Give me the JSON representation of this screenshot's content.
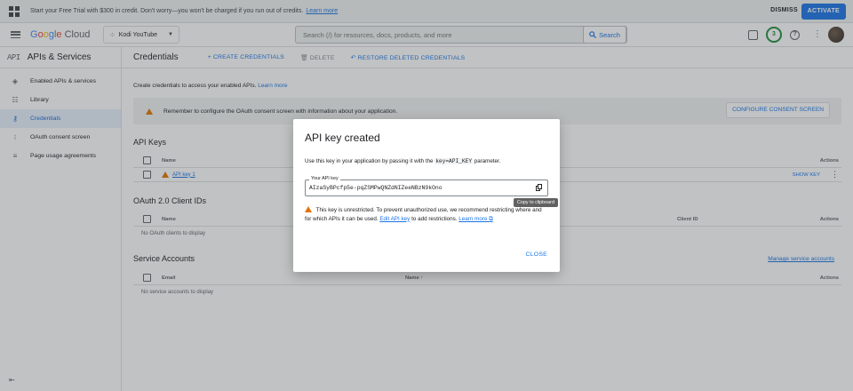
{
  "banner": {
    "text": "Start your Free Trial with $300 in credit. Don't worry—you won't be charged if you run out of credits.",
    "link": "Learn more",
    "dismiss": "DISMISS",
    "activate": "ACTIVATE"
  },
  "topbar": {
    "logo_parts": [
      "G",
      "o",
      "o",
      "g",
      "l",
      "e"
    ],
    "logo_suffix": " Cloud",
    "project": "Kodi YouTube",
    "search_placeholder": "Search (/) for resources, docs, products, and more",
    "search_button": "Search",
    "notification_count": "3"
  },
  "sidebar": {
    "api_mark": "API",
    "title": "APIs & Services",
    "items": [
      {
        "label": "Enabled APIs & services",
        "icon": "diamond-icon"
      },
      {
        "label": "Library",
        "icon": "library-icon"
      },
      {
        "label": "Credentials",
        "icon": "key-icon",
        "active": true
      },
      {
        "label": "OAuth consent screen",
        "icon": "consent-icon"
      },
      {
        "label": "Page usage agreements",
        "icon": "settings-list-icon"
      }
    ]
  },
  "toolbar": {
    "title": "Credentials",
    "create": "+ CREATE CREDENTIALS",
    "delete": "DELETE",
    "restore": "RESTORE DELETED CREDENTIALS"
  },
  "content": {
    "intro": "Create credentials to access your enabled APIs.",
    "intro_link": "Learn more",
    "warning": "Remember to configure the OAuth consent screen with information about your application.",
    "configure_button": "CONFIGURE CONSENT SCREEN",
    "api_keys_title": "API Keys",
    "api_keys_headers": {
      "name": "Name",
      "actions": "Actions"
    },
    "api_key_row": {
      "name": "API key 1",
      "action": "SHOW KEY"
    },
    "oauth_title": "OAuth 2.0 Client IDs",
    "oauth_headers": {
      "name": "Name",
      "client_id": "Client ID",
      "actions": "Actions"
    },
    "oauth_empty": "No OAuth clients to display",
    "service_title": "Service Accounts",
    "manage_service": "Manage service accounts",
    "service_headers": {
      "email": "Email",
      "name": "Name",
      "actions": "Actions"
    },
    "service_empty": "No service accounts to display"
  },
  "dialog": {
    "title": "API key created",
    "text_before": "Use this key in your application by passing it with the",
    "param": "key=API_KEY",
    "text_after": "parameter.",
    "key_label": "Your API key",
    "key_value": "AIzaSyBPcfp5e-pqZSMPwQNZdNIZeeNBzN9kOno",
    "tooltip": "Copy to clipboard",
    "warning_text": "This key is unrestricted. To prevent unauthorized use, we recommend restricting where and for which APIs it can be used.",
    "edit_link": "Edit API key",
    "warning_suffix": "to add restrictions.",
    "learn_more": "Learn more",
    "close": "CLOSE"
  }
}
